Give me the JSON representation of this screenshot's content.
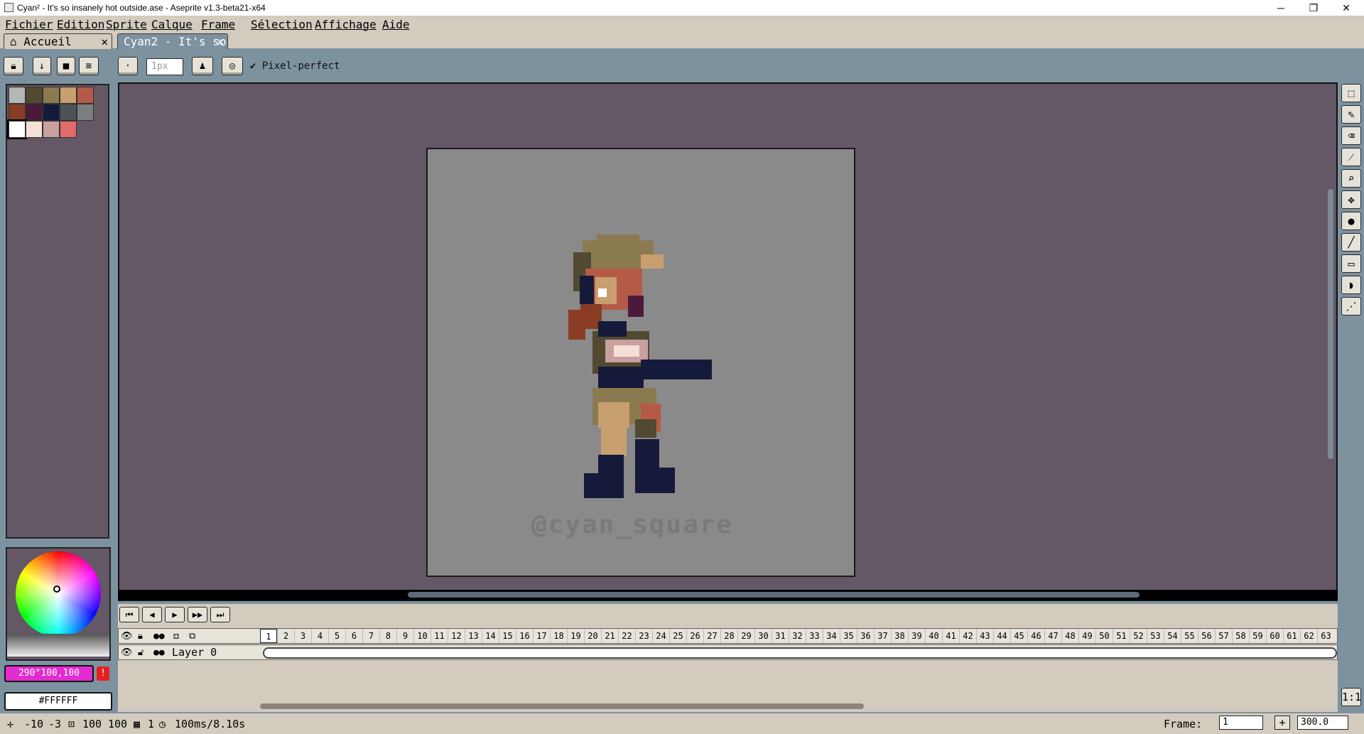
{
  "window": {
    "title": "Cyan² - It's so insanely hot outside.ase - Aseprite v1.3-beta21-x64",
    "minimize": "─",
    "maximize": "❐",
    "close": "✕"
  },
  "menu": [
    "Fichier",
    "Edition",
    "Sprite",
    "Calque",
    "Frame",
    "Sélection",
    "Affichage",
    "Aide"
  ],
  "tabs": [
    {
      "label": "Accueil",
      "close": "✕"
    },
    {
      "label": "Cyan2 - It's so",
      "close": "✕"
    }
  ],
  "toolbar": {
    "brush_size": "1px",
    "pixel_perfect": "Pixel-perfect"
  },
  "palette": {
    "colors": [
      "#b6b6b6",
      "#514a30",
      "#8b7a50",
      "#c89f6e",
      "#b55a47",
      "#8a3c24",
      "#4b1a3a",
      "#161a3a",
      "#4e5259",
      "#7a7f80",
      "#ffffff",
      "#f4e0d4",
      "#c8a0a0",
      "#e36a6a"
    ],
    "selected_index": 10
  },
  "canvas": {
    "watermark": "@cyan_square"
  },
  "colors": {
    "foreground_label": "290°100,100",
    "foreground": "#e22ccf",
    "background_label": "#FFFFFF",
    "background": "#ffffff",
    "warning": "!"
  },
  "timeline": {
    "layer_name": "Layer 0",
    "frames": [
      "1",
      "2",
      "3",
      "4",
      "5",
      "6",
      "7",
      "8",
      "9",
      "10",
      "11",
      "12",
      "13",
      "14",
      "15",
      "16",
      "17",
      "18",
      "19",
      "20",
      "21",
      "22",
      "23",
      "24",
      "25",
      "26",
      "27",
      "28",
      "29",
      "30",
      "31",
      "32",
      "33",
      "34",
      "35",
      "36",
      "37",
      "38",
      "39",
      "40",
      "41",
      "42",
      "43",
      "44",
      "45",
      "46",
      "47",
      "48",
      "49",
      "50",
      "51",
      "52",
      "53",
      "54",
      "55",
      "56",
      "57",
      "58",
      "59",
      "60",
      "61",
      "62",
      "63"
    ],
    "current_frame": "1"
  },
  "status": {
    "cursor_x": "-10",
    "cursor_y": "-3",
    "sprite_w": "100",
    "sprite_h": "100",
    "frame_num": "1",
    "duration": "100ms/8.10s",
    "frame_label": "Frame:",
    "frame_value": "1",
    "zoom_value": "300.0",
    "fit_label": "1:1"
  }
}
